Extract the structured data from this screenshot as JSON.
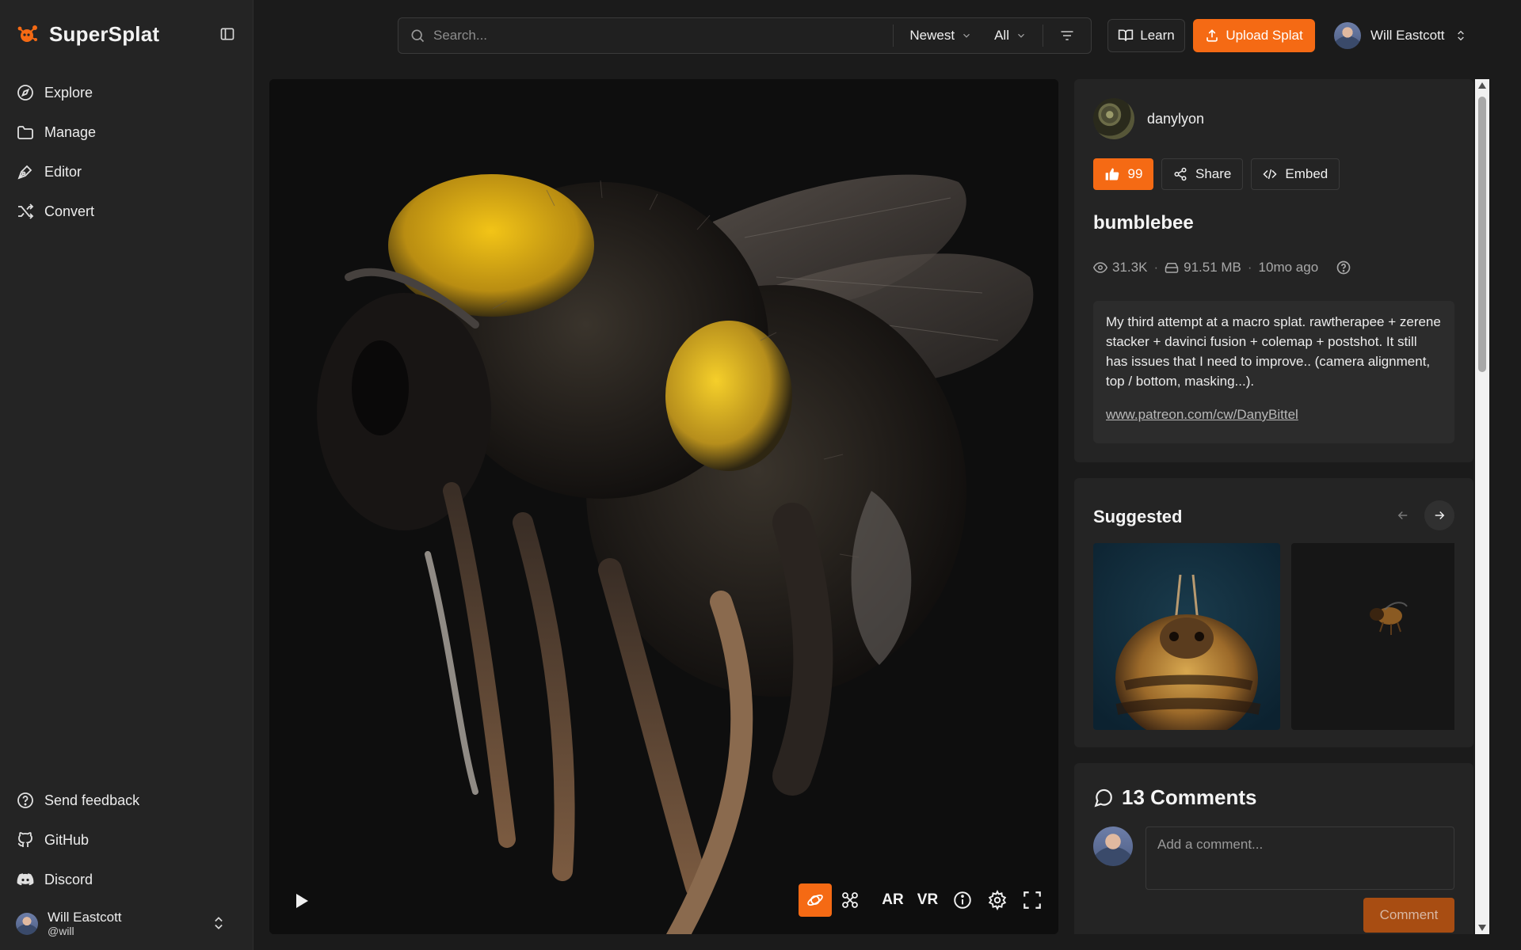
{
  "app": {
    "name": "SuperSplat"
  },
  "sidebar": {
    "nav": [
      {
        "label": "Explore",
        "icon": "compass-icon"
      },
      {
        "label": "Manage",
        "icon": "folder-icon"
      },
      {
        "label": "Editor",
        "icon": "pen-tool-icon"
      },
      {
        "label": "Convert",
        "icon": "shuffle-icon"
      }
    ],
    "bottom": [
      {
        "label": "Send feedback",
        "icon": "help-circle-icon"
      },
      {
        "label": "GitHub",
        "icon": "github-icon"
      },
      {
        "label": "Discord",
        "icon": "discord-icon"
      }
    ],
    "user": {
      "name": "Will Eastcott",
      "handle": "@will"
    }
  },
  "topbar": {
    "search_placeholder": "Search...",
    "sort_label": "Newest",
    "filter_label": "All",
    "learn_label": "Learn",
    "upload_label": "Upload Splat",
    "user_name": "Will Eastcott"
  },
  "viewer": {
    "tools": [
      "orbit-icon",
      "fly-icon",
      "AR",
      "VR",
      "info-icon",
      "settings-icon",
      "fullscreen-icon"
    ],
    "ar_label": "AR",
    "vr_label": "VR"
  },
  "splat": {
    "author": "danylyon",
    "likes": "99",
    "share_label": "Share",
    "embed_label": "Embed",
    "title": "bumblebee",
    "views": "31.3K",
    "size": "91.51 MB",
    "age": "10mo ago",
    "description": "My third attempt at a macro splat. rawtherapee + zerene stacker + davinci fusion + colemap + postshot. It still has issues that I need to improve.. (camera alignment, top / bottom, masking...).",
    "link": "www.patreon.com/cw/DanyBittel"
  },
  "suggested": {
    "title": "Suggested"
  },
  "comments": {
    "title": "13 Comments",
    "placeholder": "Add a comment...",
    "button": "Comment"
  },
  "colors": {
    "accent": "#f56a14",
    "background": "#1b1b1b",
    "panel": "#242424"
  }
}
